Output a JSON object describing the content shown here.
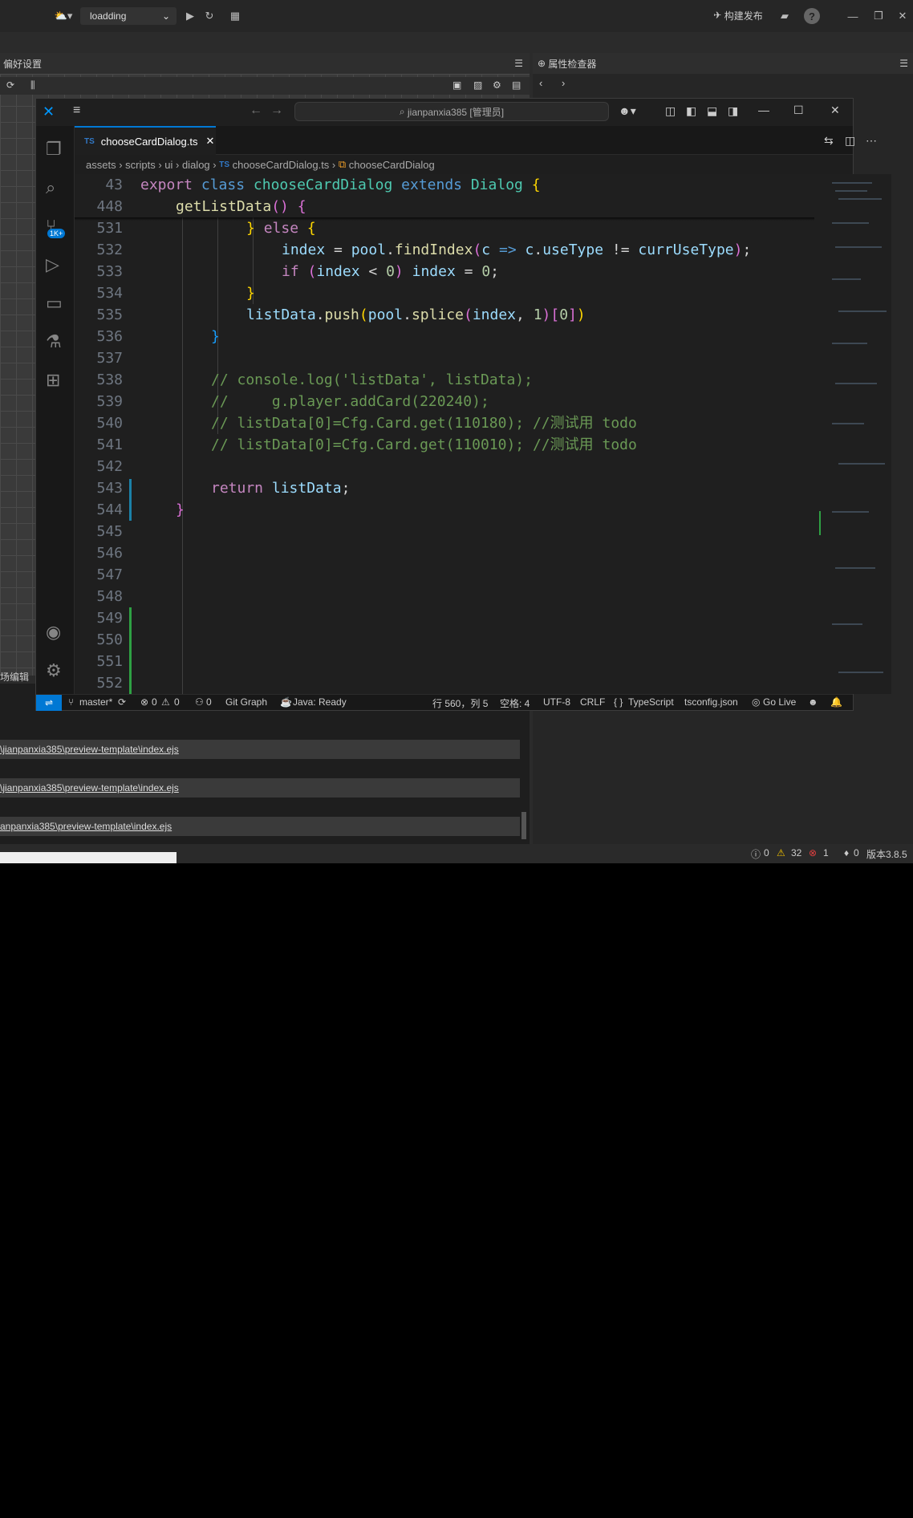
{
  "cocos": {
    "scene_name": "loadding",
    "build_label": "构建发布",
    "left_panel_title": "偏好设置",
    "right_panel_title": "属性检查器",
    "editor_label": "场编辑器",
    "console_lines": [
      "\\jianpanxia385\\preview-template\\index.ejs",
      "\\jianpanxia385\\preview-template\\index.ejs",
      "anpanxia385\\preview-template\\index.ejs"
    ],
    "status_info": "0",
    "status_warn": "32",
    "status_err": "1",
    "status_misc": "0",
    "version": "版本3.8.5"
  },
  "vscode": {
    "search_text": "jianpanxia385 [管理员]",
    "tab_label": "chooseCardDialog.ts",
    "tab_icon": "TS",
    "breadcrumb": {
      "items": [
        "assets",
        "scripts",
        "ui",
        "dialog"
      ],
      "file": "chooseCardDialog.ts",
      "symbol": "chooseCardDialog"
    },
    "scm_badge": "1K+",
    "status": {
      "branch": "master*",
      "errors": "0",
      "warnings": "0",
      "ports": "0",
      "git_graph": "Git Graph",
      "java": "Java: Ready",
      "position": "行 560，列 5",
      "spaces": "空格: 4",
      "encoding": "UTF-8",
      "eol": "CRLF",
      "language": "TypeScript",
      "tsconfig": "tsconfig.json",
      "golive": "Go Live"
    },
    "lines": [
      {
        "n": "43"
      },
      {
        "n": "448"
      },
      {
        "n": "531"
      },
      {
        "n": "532"
      },
      {
        "n": "533"
      },
      {
        "n": "534"
      },
      {
        "n": "535"
      },
      {
        "n": "536"
      },
      {
        "n": "537"
      },
      {
        "n": "538"
      },
      {
        "n": "539"
      },
      {
        "n": "540"
      },
      {
        "n": "541"
      },
      {
        "n": "542"
      },
      {
        "n": "543"
      },
      {
        "n": "544"
      },
      {
        "n": "545"
      },
      {
        "n": "546"
      },
      {
        "n": "547"
      },
      {
        "n": "548"
      },
      {
        "n": "549"
      },
      {
        "n": "550"
      },
      {
        "n": "551"
      },
      {
        "n": "552"
      }
    ],
    "code_tokens": {
      "export": "export",
      "class": "class",
      "classname": "chooseCardDialog",
      "extends": "extends",
      "Dialog": "Dialog",
      "getListData": "getListData",
      "else": "else",
      "index": "index",
      "pool": "pool",
      "findIndex": "findIndex",
      "c": "c",
      "useType": "useType",
      "currUseType": "currUseType",
      "if": "if",
      "zero": "0",
      "listData": "listData",
      "push": "push",
      "splice": "splice",
      "one": "1",
      "cmt1": "// console.log('listData', listData);",
      "cmt2": "//     g.player.addCard(220240);",
      "cmt3": "// listData[0]=Cfg.Card.get(110180); //测试用 todo",
      "cmt4": "// listData[0]=Cfg.Card.get(110010); //测试用 todo",
      "return": "return"
    }
  }
}
